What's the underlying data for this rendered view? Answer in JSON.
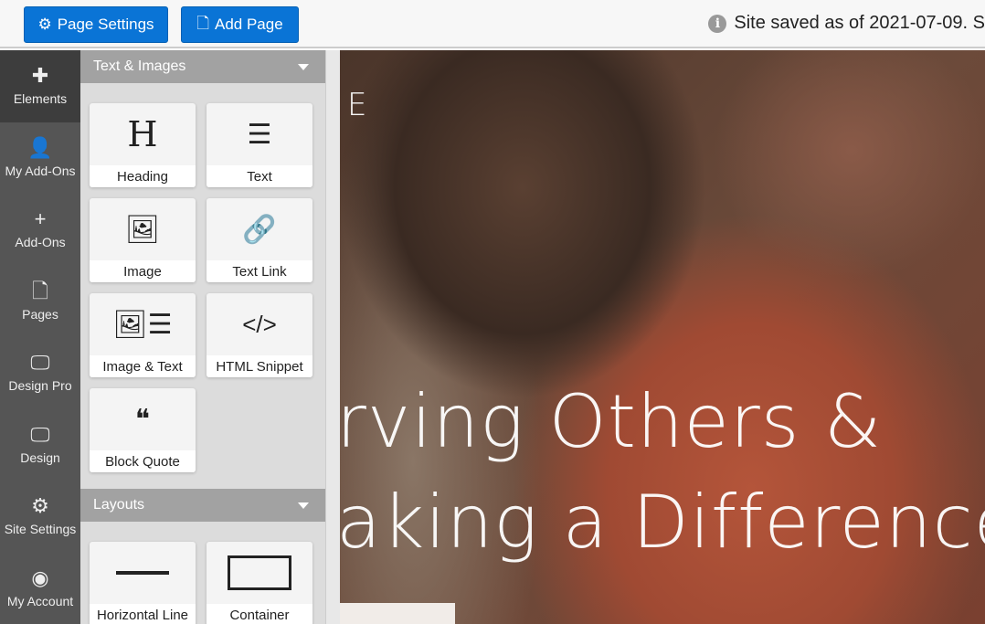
{
  "toolbar": {
    "page_settings": "Page Settings",
    "add_page": "Add Page",
    "status": "Site saved as of 2021-07-09. S"
  },
  "nav": [
    {
      "label": "Elements",
      "icon": "puzzle-icon",
      "glyph": "✚"
    },
    {
      "label": "My Add-Ons",
      "icon": "user-plus-icon",
      "glyph": "👤"
    },
    {
      "label": "Add-Ons",
      "icon": "plus-icon",
      "glyph": "+"
    },
    {
      "label": "Pages",
      "icon": "page-icon",
      "glyph": "🗋"
    },
    {
      "label": "Design Pro",
      "icon": "monitor-pen-icon",
      "glyph": "🖵"
    },
    {
      "label": "Design",
      "icon": "monitor-icon",
      "glyph": "🖵"
    },
    {
      "label": "Site Settings",
      "icon": "gear-icon",
      "glyph": "⚙"
    },
    {
      "label": "My Account",
      "icon": "account-icon",
      "glyph": "◉"
    }
  ],
  "sections": {
    "text_images": "Text & Images",
    "layouts": "Layouts"
  },
  "tiles": [
    {
      "label": "Heading",
      "glyph": "H"
    },
    {
      "label": "Text",
      "glyph": "☰"
    },
    {
      "label": "Image",
      "glyph": "🖼"
    },
    {
      "label": "Text Link",
      "glyph": "🔗"
    },
    {
      "label": "Image & Text",
      "glyph": "🖼☰"
    },
    {
      "label": "HTML Snippet",
      "glyph": "</>"
    },
    {
      "label": "Block Quote",
      "glyph": "❝"
    }
  ],
  "layout_tiles": [
    {
      "label": "Horizontal Line"
    },
    {
      "label": "Container"
    }
  ],
  "canvas": {
    "corner": "E",
    "line1": "rving Others &",
    "line2": "aking a Difference"
  }
}
